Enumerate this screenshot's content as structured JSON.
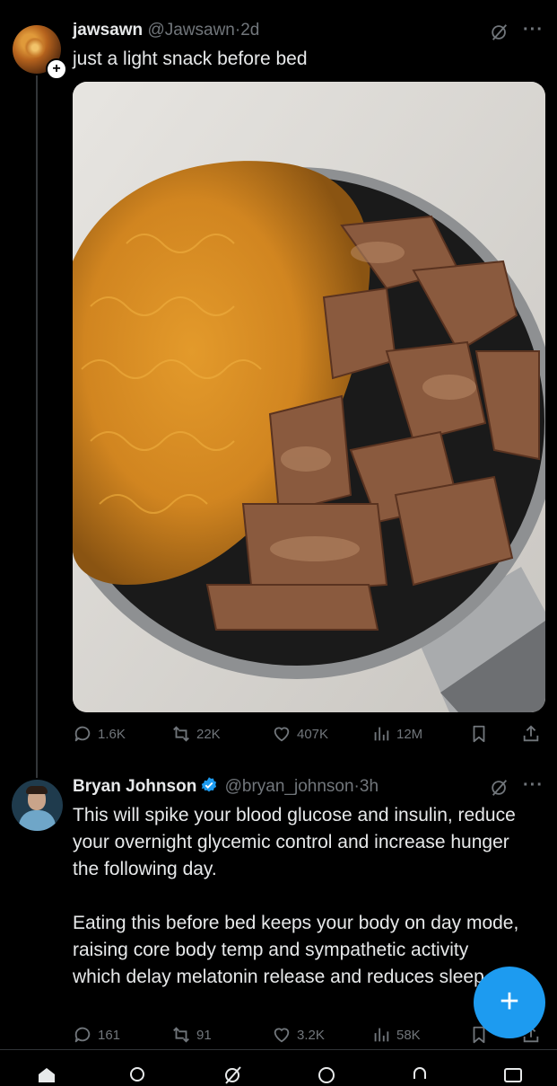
{
  "post1": {
    "name": "jawsawn",
    "handle": "@Jawsawn",
    "separator": "·",
    "time": "2d",
    "text": "just a light snack before bed",
    "image_alt": "pot of ramen noodles with seared pork",
    "stats": {
      "replies": "1.6K",
      "reposts": "22K",
      "likes": "407K",
      "views": "12M"
    }
  },
  "post2": {
    "name": "Bryan Johnson",
    "handle": "@bryan_johnson",
    "separator": "·",
    "time": "3h",
    "paragraph1": "This will spike your blood glucose and insulin, reduce your overnight glycemic control and increase hunger the following day.",
    "paragraph2": "Eating this before bed keeps your body on day mode, raising core body temp and sympathetic activity which delay melatonin release and reduces sleep.",
    "stats": {
      "replies": "161",
      "reposts": "91",
      "likes": "3.2K",
      "views": "58K"
    }
  },
  "fab": {
    "label": "+"
  },
  "icons": {
    "follow": "plus-icon",
    "verified": "verified-badge-icon",
    "grok": "grok-icon",
    "more": "more-icon",
    "reply": "reply-icon",
    "repost": "repost-icon",
    "like": "heart-icon",
    "views": "views-icon",
    "bookmark": "bookmark-icon",
    "share": "share-icon"
  },
  "colors": {
    "background": "#000000",
    "text": "#e7e9ea",
    "muted": "#71767b",
    "accent": "#1d9bf0"
  }
}
